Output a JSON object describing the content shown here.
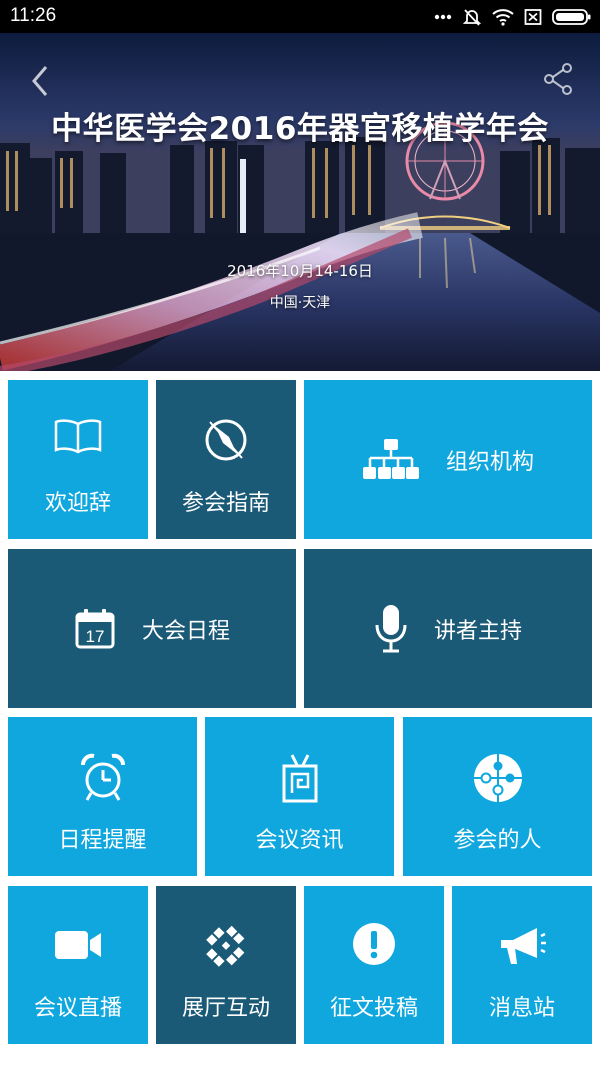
{
  "status_bar": {
    "time": "11:26",
    "icons": [
      "more-dots-icon",
      "mute-icon",
      "wifi-icon",
      "sim-off-icon",
      "battery-icon"
    ]
  },
  "header": {
    "title": "中华医学会2016年器官移植学年会",
    "date": "2016年10月14-16日",
    "location": "中国·天津",
    "back_icon": "chevron-left-icon",
    "share_icon": "share-icon"
  },
  "colors": {
    "tile_light": "#10a7de",
    "tile_dark": "#1b5a76",
    "status_bar": "#000000"
  },
  "menu": {
    "welcome": {
      "label": "欢迎辞",
      "icon": "book-icon"
    },
    "guide": {
      "label": "参会指南",
      "icon": "compass-icon"
    },
    "organization": {
      "label": "组织机构",
      "icon": "org-chart-icon"
    },
    "schedule": {
      "label": "大会日程",
      "icon": "calendar-icon",
      "calendar_day": "17"
    },
    "speakers": {
      "label": "讲者主持",
      "icon": "microphone-icon"
    },
    "reminder": {
      "label": "日程提醒",
      "icon": "alarm-clock-icon"
    },
    "news": {
      "label": "会议资讯",
      "icon": "tv-icon"
    },
    "attendees": {
      "label": "参会的人",
      "icon": "puzzle-icon"
    },
    "live": {
      "label": "会议直播",
      "icon": "video-camera-icon"
    },
    "exhibition": {
      "label": "展厅互动",
      "icon": "diamond-pattern-icon"
    },
    "submission": {
      "label": "征文投稿",
      "icon": "exclamation-icon"
    },
    "messages": {
      "label": "消息站",
      "icon": "megaphone-icon"
    }
  }
}
